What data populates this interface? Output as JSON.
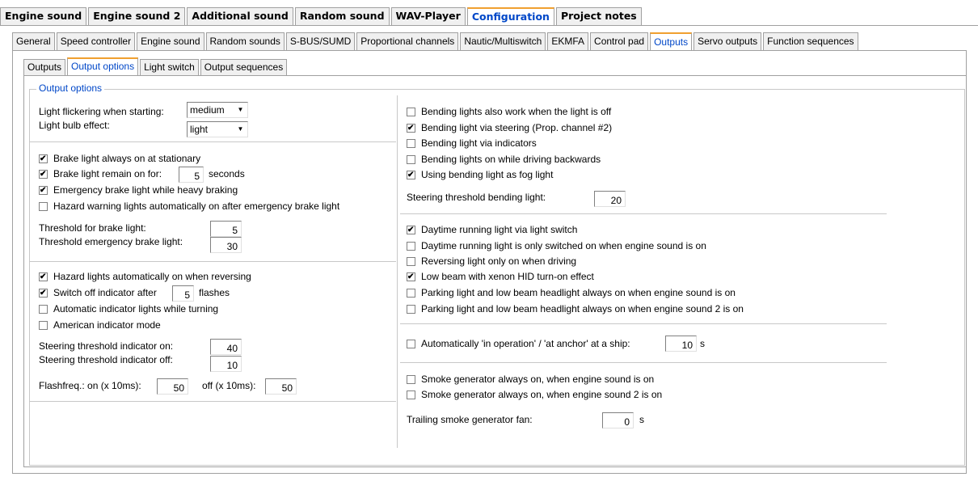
{
  "top_tabs": [
    "Engine sound",
    "Engine sound 2",
    "Additional sound",
    "Random sound",
    "WAV-Player",
    "Configuration",
    "Project notes"
  ],
  "config_tabs": [
    "General",
    "Speed controller",
    "Engine sound",
    "Random sounds",
    "S-BUS/SUMD",
    "Proportional channels",
    "Nautic/Multiswitch",
    "EKMFA",
    "Control pad",
    "Outputs",
    "Servo outputs",
    "Function sequences"
  ],
  "output_tabs": [
    "Outputs",
    "Output options",
    "Light switch",
    "Output sequences"
  ],
  "group_title": "Output options",
  "left": {
    "flicker_label": "Light flickering when starting:",
    "flicker_value": "medium",
    "bulb_label": "Light bulb effect:",
    "bulb_value": "light",
    "brake_always": "Brake light always on at stationary",
    "brake_remain_prefix": "Brake light remain on for:",
    "brake_remain_value": "5",
    "brake_remain_suffix": "seconds",
    "emergency_brake": "Emergency brake light while heavy braking",
    "hazard_after_emergency": "Hazard warning lights automatically on after emergency brake light",
    "threshold_brake_label": "Threshold for brake light:",
    "threshold_brake_value": "5",
    "threshold_emergency_label": "Threshold emergency brake light:",
    "threshold_emergency_value": "30",
    "hazard_reversing": "Hazard lights automatically on when reversing",
    "switch_off_prefix": "Switch off indicator after",
    "switch_off_value": "5",
    "switch_off_suffix": "flashes",
    "auto_indicator": "Automatic indicator lights while turning",
    "american_indicator": "American indicator mode",
    "steer_on_label": "Steering threshold indicator on:",
    "steer_on_value": "40",
    "steer_off_label": "Steering threshold indicator off:",
    "steer_off_value": "10",
    "flash_on_label": "Flashfreq.:  on (x 10ms):",
    "flash_on_value": "50",
    "flash_off_label": "off (x 10ms):",
    "flash_off_value": "50"
  },
  "right": {
    "bend_off": "Bending lights also work when the light is off",
    "bend_steering": "Bending light via steering (Prop. channel #2)",
    "bend_indicators": "Bending light via indicators",
    "bend_backwards": "Bending lights on while driving backwards",
    "bend_fog": "Using bending light as fog light",
    "steer_bend_label": "Steering threshold bending light:",
    "steer_bend_value": "20",
    "drl_switch": "Daytime running light via light switch",
    "drl_engine": "Daytime running light is only switched on when engine sound is on",
    "reverse_driving": "Reversing light only on when driving",
    "xenon": "Low beam with xenon HID turn-on effect",
    "parking_engine": "Parking light and low beam headlight always on when engine sound is on",
    "parking_engine2": "Parking light and low beam headlight always on when engine sound 2 is on",
    "auto_operation": "Automatically 'in operation' / 'at anchor' at a ship:",
    "auto_operation_value": "10",
    "auto_operation_unit": "s",
    "smoke_engine": "Smoke generator always on, when engine sound is on",
    "smoke_engine2": "Smoke generator always on, when engine sound 2 is on",
    "trailing_label": "Trailing smoke generator fan:",
    "trailing_value": "0",
    "trailing_unit": "s"
  },
  "colors": {
    "active_tab_text": "#0047c8",
    "active_tab_accent": "#f0a030"
  }
}
